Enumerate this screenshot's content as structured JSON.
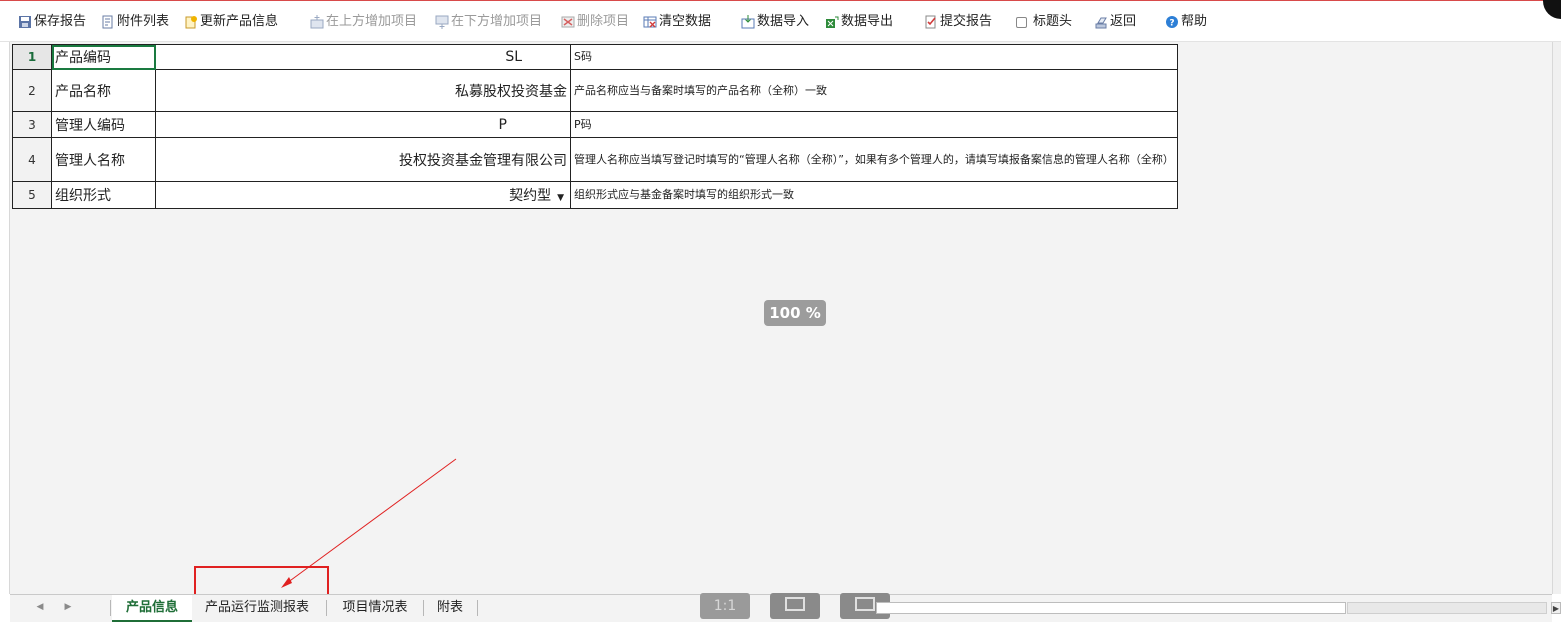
{
  "toolbar": {
    "save_report": "保存报告",
    "attachment_list": "附件列表",
    "update_product_info": "更新产品信息",
    "add_above": "在上方增加项目",
    "add_below": "在下方增加项目",
    "delete_item": "删除项目",
    "clear_data": "清空数据",
    "import_data": "数据导入",
    "export_data": "数据导出",
    "submit_report": "提交报告",
    "title_header": "标题头",
    "back": "返回",
    "help": "帮助"
  },
  "grid": {
    "rows": [
      {
        "num": "1",
        "label": "产品编码",
        "value": "SL",
        "note": "S码"
      },
      {
        "num": "2",
        "label": "产品名称",
        "value": "私募股权投资基金",
        "note": "产品名称应当与备案时填写的产品名称（全称）一致"
      },
      {
        "num": "3",
        "label": "管理人编码",
        "value": "P",
        "note": "P码"
      },
      {
        "num": "4",
        "label": "管理人名称",
        "value": "投权投资基金管理有限公司",
        "note": "管理人名称应当填写登记时填写的“管理人名称（全称）”，如果有多个管理人的，请填写填报备案信息的管理人名称（全称）"
      },
      {
        "num": "5",
        "label": "组织形式",
        "value": "契约型",
        "note": "组织形式应与基金备案时填写的组织形式一致"
      }
    ]
  },
  "zoom_label": "100 %",
  "sheet_tabs": [
    "产品信息",
    "产品运行监测报表",
    "项目情况表",
    "附表"
  ],
  "controls": {
    "ratio": "1:1"
  },
  "colors": {
    "accent_green": "#1f6e37",
    "annotation_red": "#e02020",
    "workspace_bg": "#f3f3f3"
  },
  "icons": [
    "save-icon",
    "attachment-icon",
    "update-icon",
    "add-above-icon",
    "add-below-icon",
    "delete-icon",
    "clear-icon",
    "import-icon",
    "export-icon",
    "submit-icon",
    "back-icon",
    "help-icon",
    "fit-screen-icon",
    "view-mode-icon"
  ]
}
